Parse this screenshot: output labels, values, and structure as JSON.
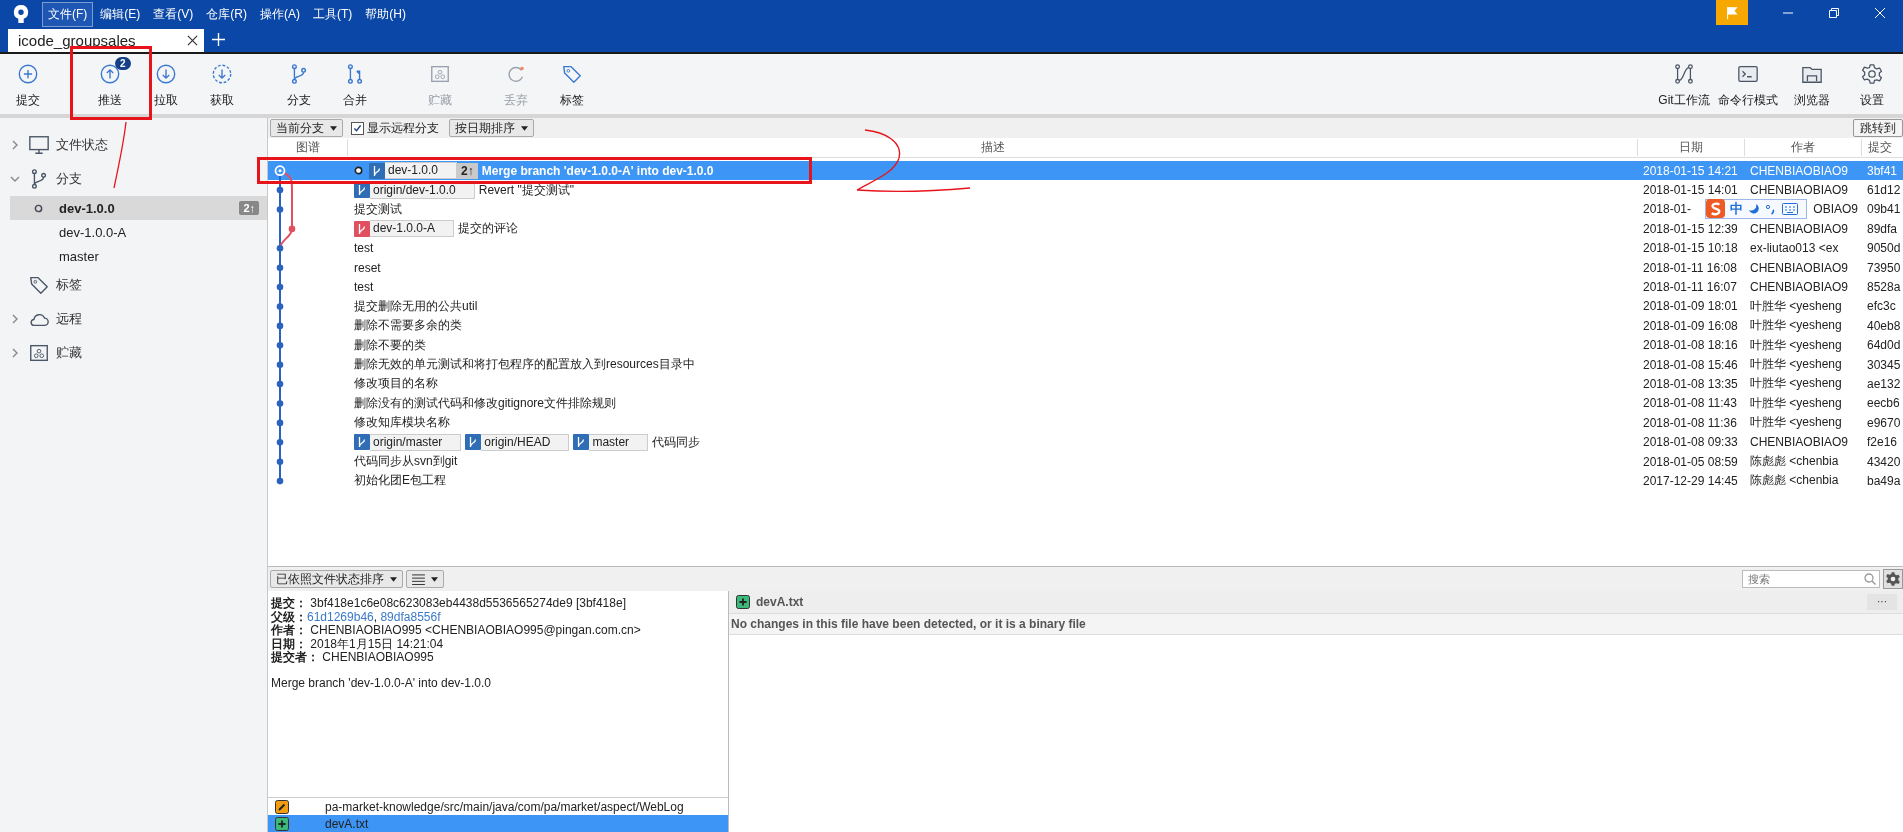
{
  "menu": [
    {
      "label": "文件(F)",
      "selected": true
    },
    {
      "label": "编辑(E)",
      "selected": false
    },
    {
      "label": "查看(V)",
      "selected": false
    },
    {
      "label": "仓库(R)",
      "selected": false
    },
    {
      "label": "操作(A)",
      "selected": false
    },
    {
      "label": "工具(T)",
      "selected": false
    },
    {
      "label": "帮助(H)",
      "selected": false
    }
  ],
  "tabs": [
    {
      "label": "icode_groupsales",
      "selected": true
    }
  ],
  "toolbar": {
    "left": [
      {
        "label": "提交",
        "disabled": false
      },
      {
        "label": "推送",
        "disabled": false,
        "badge": "2"
      },
      {
        "label": "拉取",
        "disabled": false
      },
      {
        "label": "获取",
        "disabled": false
      },
      {
        "label": "分支",
        "disabled": false
      },
      {
        "label": "合并",
        "disabled": false
      },
      {
        "label": "贮藏",
        "disabled": true
      },
      {
        "label": "丢弃",
        "disabled": true
      },
      {
        "label": "标签",
        "disabled": false
      }
    ],
    "right": [
      {
        "label": "Git工作流"
      },
      {
        "label": "命令行模式"
      },
      {
        "label": "浏览器"
      },
      {
        "label": "设置"
      }
    ]
  },
  "sidebar": {
    "sections": [
      {
        "label": "文件状态",
        "expanded": false
      },
      {
        "label": "分支",
        "expanded": true,
        "items": [
          {
            "label": "dev-1.0.0",
            "selected": true,
            "current": true,
            "badge": "2↑"
          },
          {
            "label": "dev-1.0.0-A",
            "selected": false,
            "current": false
          },
          {
            "label": "master",
            "selected": false,
            "current": false
          }
        ]
      },
      {
        "label": "标签"
      },
      {
        "label": "远程",
        "expanded": false
      },
      {
        "label": "贮藏",
        "expanded": false
      }
    ]
  },
  "filter_bar": {
    "branch_dropdown": "当前分支",
    "show_remote": {
      "label": "显示远程分支",
      "checked": true
    },
    "sort_dropdown": "按日期排序",
    "jump_button": "跳转到"
  },
  "columns": [
    "图谱",
    "描述",
    "日期",
    "作者",
    "提交"
  ],
  "rows": [
    {
      "selected": true,
      "covered": false,
      "refs": [
        {
          "name": "dev-1.0.0",
          "color": "#2f6db5",
          "current": true,
          "ahead": "2↑"
        }
      ],
      "message": "Merge branch 'dev-1.0.0-A' into dev-1.0.0",
      "date": "2018-01-15 14:21",
      "author": "CHENBIAOBIAO9",
      "commit": "3bf41"
    },
    {
      "selected": false,
      "covered": false,
      "refs": [
        {
          "name": "origin/dev-1.0.0",
          "color": "#2f6db5",
          "current": false
        }
      ],
      "message": "Revert \"提交测试\"",
      "date": "2018-01-15 14:01",
      "author": "CHENBIAOBIAO9",
      "commit": "61d12"
    },
    {
      "selected": false,
      "covered": true,
      "message": "提交测试",
      "date": "2018-01-",
      "author": "OBIAO9",
      "commit": "09b41"
    },
    {
      "selected": false,
      "covered": false,
      "refs": [
        {
          "name": "dev-1.0.0-A",
          "color": "#e0505f",
          "current": false
        }
      ],
      "message": "提交的评论",
      "date": "2018-01-15 12:39",
      "author": "CHENBIAOBIAO9",
      "commit": "89dfa"
    },
    {
      "selected": false,
      "covered": false,
      "message": "test",
      "date": "2018-01-15 10:18",
      "author": "ex-liutao013 <ex",
      "commit": "9050d"
    },
    {
      "selected": false,
      "covered": false,
      "message": "reset",
      "date": "2018-01-11 16:08",
      "author": "CHENBIAOBIAO9",
      "commit": "73950"
    },
    {
      "selected": false,
      "covered": false,
      "message": "test",
      "date": "2018-01-11 16:07",
      "author": "CHENBIAOBIAO9",
      "commit": "8528a"
    },
    {
      "selected": false,
      "covered": false,
      "message": "提交删除无用的公共util",
      "date": "2018-01-09 18:01",
      "author": "叶胜华 <yesheng",
      "commit": "efc3c"
    },
    {
      "selected": false,
      "covered": false,
      "message": "删除不需要多余的类",
      "date": "2018-01-09 16:08",
      "author": "叶胜华 <yesheng",
      "commit": "40eb8"
    },
    {
      "selected": false,
      "covered": false,
      "message": "删除不要的类",
      "date": "2018-01-08 18:16",
      "author": "叶胜华 <yesheng",
      "commit": "64d0d"
    },
    {
      "selected": false,
      "covered": false,
      "message": "删除无效的单元测试和将打包程序的配置放入到resources目录中",
      "date": "2018-01-08 15:46",
      "author": "叶胜华 <yesheng",
      "commit": "30345"
    },
    {
      "selected": false,
      "covered": false,
      "message": "修改项目的名称",
      "date": "2018-01-08 13:35",
      "author": "叶胜华 <yesheng",
      "commit": "ae132"
    },
    {
      "selected": false,
      "covered": false,
      "message": "删除没有的测试代码和修改gitignore文件排除规则",
      "date": "2018-01-08 11:43",
      "author": "叶胜华 <yesheng",
      "commit": "eecb6"
    },
    {
      "selected": false,
      "covered": false,
      "message": "修改知库模块名称",
      "date": "2018-01-08 11:36",
      "author": "叶胜华 <yesheng",
      "commit": "e9670"
    },
    {
      "selected": false,
      "covered": false,
      "refs": [
        {
          "name": "origin/master",
          "color": "#2f6db5",
          "current": false
        },
        {
          "name": "origin/HEAD",
          "color": "#2f6db5",
          "current": false
        },
        {
          "name": "master",
          "color": "#2f6db5",
          "current": false
        }
      ],
      "message": "代码同步",
      "date": "2018-01-08 09:33",
      "author": "CHENBIAOBIAO9",
      "commit": "f2e16"
    },
    {
      "selected": false,
      "covered": false,
      "message": "代码同步从svn到git",
      "date": "2018-01-05 08:59",
      "author": "陈彪彪 <chenbia",
      "commit": "43420"
    },
    {
      "selected": false,
      "covered": false,
      "message": "初始化团E包工程",
      "date": "2017-12-29 14:45",
      "author": "陈彪彪 <chenbia",
      "commit": "ba49a"
    }
  ],
  "ime_toolbar": {
    "mode": "中"
  },
  "bottom": {
    "sort_dropdown": "已依照文件状态排序",
    "search": {
      "placeholder": "搜索"
    },
    "details": [
      {
        "kind": "text",
        "text": "**提交：** 3bf418e1c6e08c623083eb4438d5536565274de9 [3bf418e]"
      },
      {
        "kind": "links",
        "label": "父级：",
        "links": [
          "61d1269b46",
          "89dfa8556f"
        ],
        "separator": ", "
      },
      {
        "kind": "text",
        "text": "**作者：** CHENBIAOBIAO995 <CHENBIAOBIAO995@pingan.com.cn>"
      },
      {
        "kind": "text",
        "text": "**日期：** 2018年1月15日 14:21:04"
      },
      {
        "kind": "text",
        "text": "**提交者：** CHENBIAOBIAO995"
      }
    ],
    "message": "Merge branch 'dev-1.0.0-A' into dev-1.0.0",
    "files": [
      {
        "name": "pa-market-knowledge/src/main/java/com/pa/market/aspect/WebLog",
        "kind": "modified",
        "selected": false
      },
      {
        "name": "devA.txt",
        "kind": "added",
        "selected": true
      }
    ],
    "diff": {
      "file": "devA.txt",
      "kind": "added",
      "more": "···",
      "notice": "No changes in this file have been detected, or it is a binary file"
    }
  }
}
